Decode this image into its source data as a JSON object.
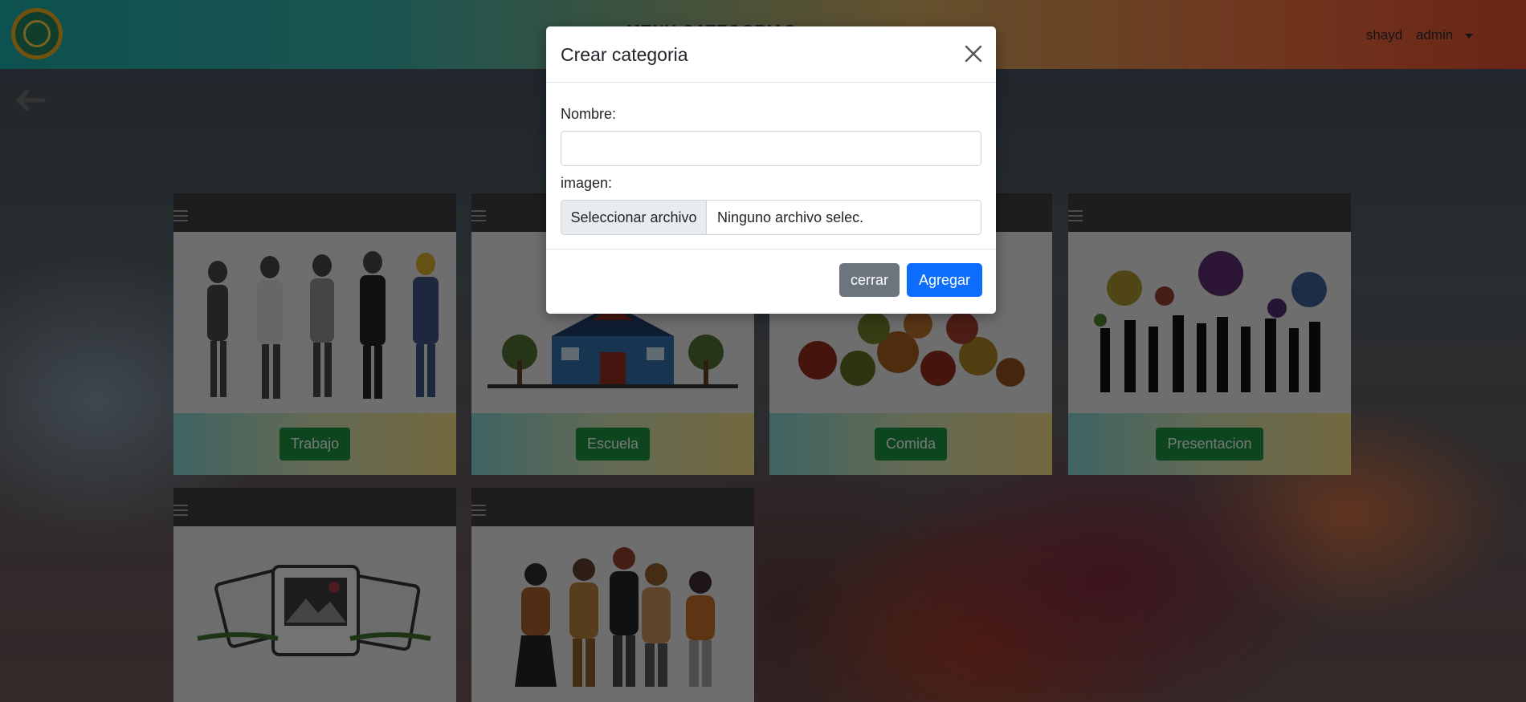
{
  "navbar": {
    "title": "MENU CATEGORIAS",
    "user_name": "shayd",
    "role": "admin"
  },
  "cards": [
    {
      "label": "Trabajo",
      "icon": "workers-image"
    },
    {
      "label": "Escuela",
      "icon": "school-image"
    },
    {
      "label": "Comida",
      "icon": "food-image"
    },
    {
      "label": "Presentacion",
      "icon": "people-talking-image"
    },
    {
      "label": "",
      "icon": "photos-image"
    },
    {
      "label": "",
      "icon": "group-people-image"
    }
  ],
  "modal": {
    "title": "Crear categoria",
    "name_label": "Nombre:",
    "name_value": "",
    "image_label": "imagen:",
    "file_button": "Seleccionar archivo",
    "file_status": "Ninguno archivo selec.",
    "close_button": "cerrar",
    "add_button": "Agregar"
  },
  "colors": {
    "primary": "#0d6efd",
    "secondary": "#6c757d",
    "card_button": "#1a8a3f"
  }
}
